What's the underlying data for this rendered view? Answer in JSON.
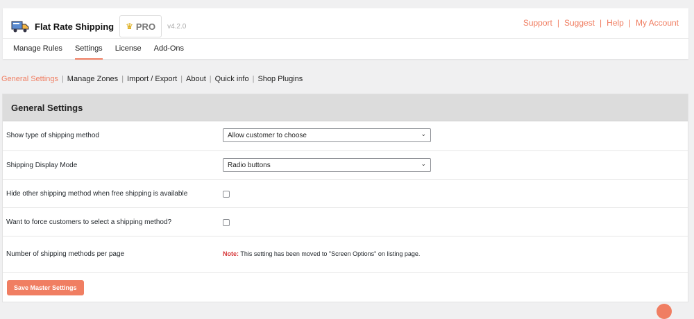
{
  "header": {
    "plugin_name": "Flat Rate Shipping",
    "pro_label": "PRO",
    "version": "v4.2.0",
    "links": [
      "Support",
      "Suggest",
      "Help",
      "My Account"
    ],
    "separator": "|"
  },
  "main_tabs": [
    {
      "label": "Manage Rules"
    },
    {
      "label": "Settings",
      "active": true
    },
    {
      "label": "License"
    },
    {
      "label": "Add-Ons"
    }
  ],
  "sub_nav": [
    {
      "label": "General Settings",
      "active": true
    },
    {
      "label": "Manage Zones"
    },
    {
      "label": "Import / Export"
    },
    {
      "label": "About"
    },
    {
      "label": "Quick info"
    },
    {
      "label": "Shop Plugins"
    }
  ],
  "panel": {
    "title": "General Settings",
    "rows": [
      {
        "label": "Show type of shipping method",
        "value": "Allow customer to choose"
      },
      {
        "label": "Shipping Display Mode",
        "value": "Radio buttons"
      },
      {
        "label": "Hide other shipping method when free shipping is available",
        "checked": false
      },
      {
        "label": "Want to force customers to select a shipping method?",
        "checked": false
      },
      {
        "label": "Number of shipping methods per page",
        "note_label": "Note:",
        "note_text": "This setting has been moved to \"Screen Options\" on listing page."
      }
    ],
    "save_label": "Save Master Settings"
  },
  "colors": {
    "accent": "#f07e62",
    "note": "#d63638"
  }
}
